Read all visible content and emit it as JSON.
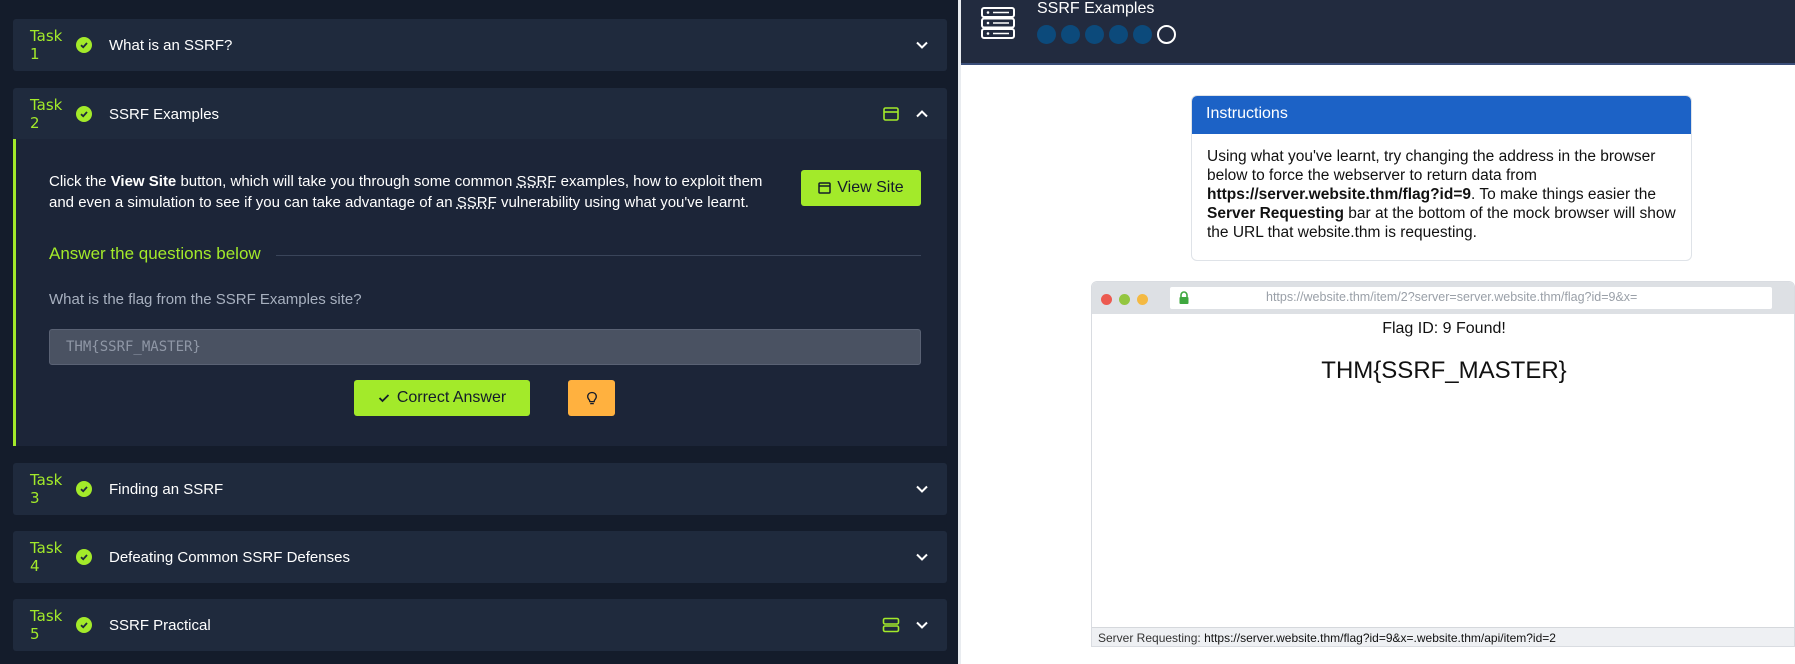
{
  "tasks": [
    {
      "number": "Task 1",
      "title": "What is an SSRF?"
    },
    {
      "number": "Task 2",
      "title": "SSRF Examples"
    },
    {
      "number": "Task 3",
      "title": "Finding an SSRF"
    },
    {
      "number": "Task 4",
      "title": "Defeating Common SSRF Defenses"
    },
    {
      "number": "Task 5",
      "title": "SSRF Practical"
    }
  ],
  "task2": {
    "para_1": "Click the ",
    "para_bold": "View Site",
    "para_2": " button, which will take you through some common ",
    "para_abbr_1": "SSRF",
    "para_3": " examples, how to exploit them and even a simulation to see if you can take advantage of an ",
    "para_abbr_2": "SSRF",
    "para_4": " vulnerability using what you've learnt.",
    "view_site_label": "View Site",
    "answer_heading": "Answer the questions below",
    "question": "What is the flag from the SSRF Examples site?",
    "answer_value": "THM{SSRF_MASTER}",
    "correct_label": "Correct Answer"
  },
  "site": {
    "title": "SSRF Examples",
    "progress_total": 6,
    "progress_current": 6,
    "instructions_title": "Instructions",
    "instr_1": "Using what you've learnt, try changing the address in the browser below to force the webserver to return data from ",
    "instr_bold_1": "https://server.website.thm/flag?id=9",
    "instr_2": ". To make things easier the ",
    "instr_bold_2": "Server Requesting",
    "instr_3": " bar at the bottom of the mock browser will show the URL that website.thm is requesting.",
    "browser_url": "https://website.thm/item/2?server=server.website.thm/flag?id=9&x=",
    "flag_found": "Flag ID: 9 Found!",
    "flag_value": "THM{SSRF_MASTER}",
    "server_requesting_label": "Server Requesting:",
    "server_requesting_url": "https://server.website.thm/flag?id=9&x=.website.thm/api/item?id=2"
  },
  "colors": {
    "accent": "#a3ea2a",
    "hint": "#ffb13f",
    "panel": "#1f2a3d",
    "instructions_header": "#1c62c6"
  }
}
